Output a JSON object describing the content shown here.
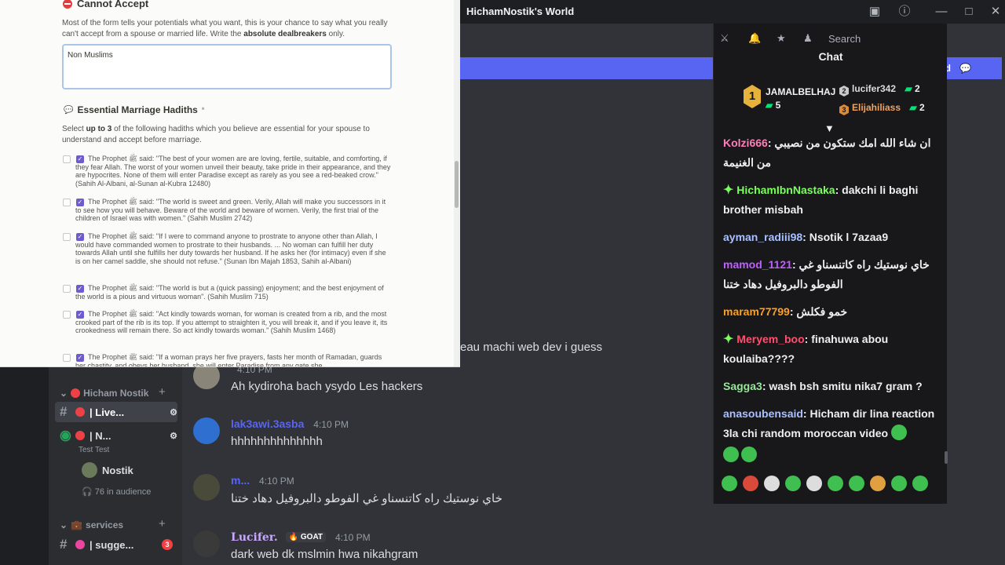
{
  "window": {
    "title": "HichamNostik's World",
    "icons": [
      "screen-share-icon",
      "help-icon",
      "minimize-icon",
      "maximize-icon",
      "close-icon"
    ]
  },
  "banner": {
    "button_label": "ad"
  },
  "form": {
    "cannot_accept_title": "Cannot Accept",
    "cannot_accept_desc_1": "Most of the form tells your potentials what you want, this is your chance to say what you really can't accept from a spouse or married life. Write the ",
    "cannot_accept_desc_bold": "absolute dealbreakers",
    "cannot_accept_desc_2": " only.",
    "cannot_accept_value": "Non Muslims",
    "hadiths_title": "Essential Marriage Hadiths",
    "hadiths_marker": "*",
    "hadiths_desc_1": "Select ",
    "hadiths_desc_bold": "up to 3",
    "hadiths_desc_2": " of the following hadiths which you believe are essential for your spouse to understand and accept before marriage.",
    "options": [
      "The Prophet ﷺ said: \"The best of your women are are loving, fertile, suitable, and comforting, if they fear Allah. The worst of your women unveil their beauty, take pride in their appearance, and they are hypocrites. None of them will enter Paradise except as rarely as you see a red-beaked crow.\" (Sahih Al-Albani, al-Sunan al-Kubra 12480)",
      "The Prophet ﷺ said: \"The world is sweet and green. Verily, Allah will make you successors in it to see how you will behave. Beware of the world and beware of women. Verily, the first trial of the children of Israel was with women.\" (Sahih Muslim 2742)",
      "The Prophet ﷺ said: \"If I were to command anyone to prostrate to anyone other than Allah, I would have commanded women to prostrate to their husbands. ... No woman can fulfill her duty towards Allah until she fulfills her duty towards her husband. If he asks her (for intimacy) even if she is on her camel saddle, she should not refuse.\" (Sunan Ibn Majah 1853, Sahih al-Albani)",
      "The Prophet ﷺ said: \"The world is but a (quick passing) enjoyment; and the best enjoyment of the world is a pious and virtuous woman\". (Sahih Muslim 715)",
      "The Prophet ﷺ said: \"Act kindly towards woman, for woman is created from a rib, and the most crooked part of the rib is its top. If you attempt to straighten it, you will break it, and if you leave it, its crookedness will remain there. So act kindly towards woman.\" (Sahih Muslim 1468)",
      "The Prophet ﷺ said: \"If a woman prays her five prayers, fasts her month of Ramadan, guards her chastity, and obeys her husband, she will enter Paradise from any gate she"
    ]
  },
  "sidebar": {
    "category_1": "Hicham Nostik",
    "channel_live": "| Live...",
    "channel_n": "| N...",
    "test_text": "Test Test",
    "user_nostik": "Nostik",
    "audience": "76 in audience",
    "category_2": "services",
    "channel_sugg": "| sugge...",
    "sugg_badge": "3"
  },
  "messages": [
    {
      "author": "",
      "time": "4:10 PM",
      "body": "Ah kydiroha bach ysydo Les hackers",
      "color": "#c9a7ff"
    },
    {
      "author": "lak3awi.3asba",
      "time": "4:10 PM",
      "body": "hhhhhhhhhhhhhh",
      "color": "#5865f2"
    },
    {
      "author": "m...",
      "time": "4:10 PM",
      "body": "خاي نوستيك راه كاتنسناو غي الفوطو دالبروفيل دهاد ختنا",
      "color": "#5865f2"
    },
    {
      "author": "Lucifer.",
      "badge": "GOAT",
      "time": "4:10 PM",
      "body": "dark web dk mslmin hwa nikahgram",
      "color": "#c9a7ff"
    }
  ],
  "ghost_text": "eau machi web dev i guess",
  "chat": {
    "search_placeholder": "Search",
    "title": "Chat",
    "leader_1_rank": "1",
    "leader_1_name": "JAMALBELHAJ",
    "leader_1_count": "5",
    "leader_2_rank": "2",
    "leader_2_name": "lucifer342",
    "leader_2_count": "2",
    "leader_3_rank": "3",
    "leader_3_name": "Elijahiliass",
    "leader_3_count": "2",
    "lines": [
      {
        "user": "Kolzi666",
        "color": "#ff7eb9",
        "text": "ان شاء الله امك ستكون من نصيبي من الغنيمة"
      },
      {
        "user": "HichamIbnNastaka",
        "color": "#7bff5c",
        "text": "dakchi li baghi brother misbah"
      },
      {
        "user": "ayman_radiii98",
        "color": "#a9c1ff",
        "text": "Nsotik l 7azaa9"
      },
      {
        "user": "mamod_1121",
        "color": "#bf5fff",
        "text": "خاي نوستيك راه كاتنسناو غي الفوطو دالبروفيل دهاد ختنا"
      },
      {
        "user": "maram77799",
        "color": "#ff9f1c",
        "text": "خمو فكلش"
      },
      {
        "user": "Meryem_boo",
        "color": "#ff4f6e",
        "text": "finahuwa abou koulaiba????"
      },
      {
        "user": "Sagga3",
        "color": "#9be59b",
        "text": "wash bsh smitu nika7 gram ?"
      },
      {
        "user": "anasoubensaid",
        "color": "#a9c1ff",
        "text": "Hicham dir lina reaction 3la chi random moroccan video"
      }
    ]
  }
}
